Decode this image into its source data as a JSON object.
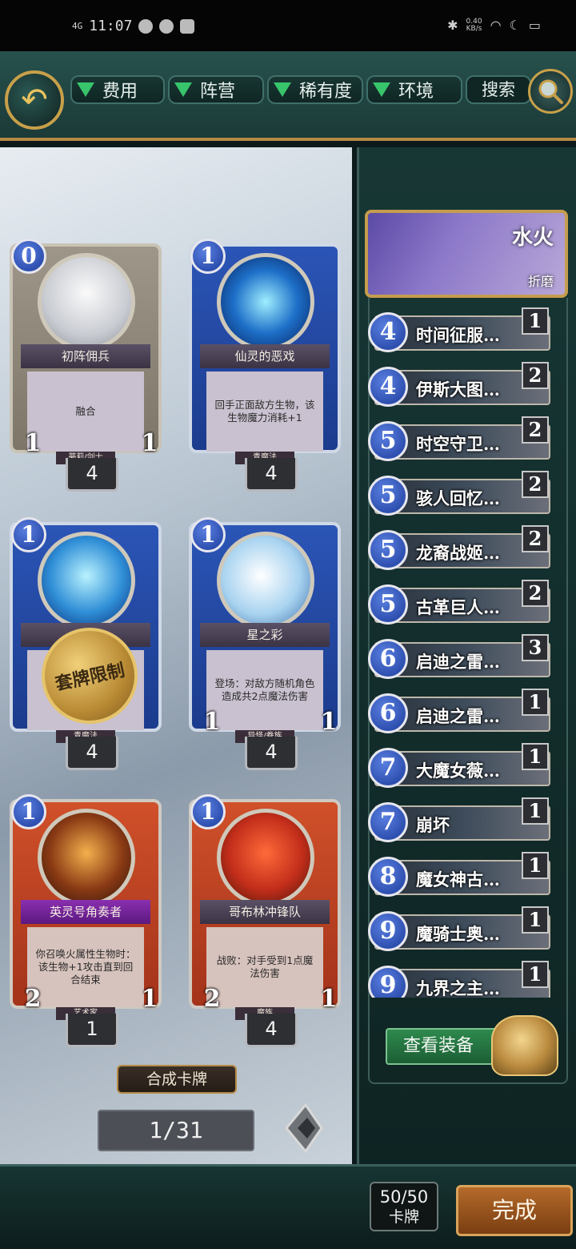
{
  "status_bar": {
    "network": "4G",
    "time": "11:07",
    "speed_top": "0.40",
    "speed_unit": "KB/s"
  },
  "filters": [
    {
      "label": "费用"
    },
    {
      "label": "阵营"
    },
    {
      "label": "稀有度"
    },
    {
      "label": "环境"
    }
  ],
  "search": {
    "label": "搜索"
  },
  "cards": [
    {
      "name": "初阵佣兵",
      "cost": "0",
      "desc": "融合",
      "tribe": "夢莉/剑士",
      "atk": "1",
      "hp": "1",
      "count": "4"
    },
    {
      "name": "仙灵的恶戏",
      "cost": "1",
      "desc": "回手正面敌方生物，该生物魔力消耗+1",
      "tribe": "青魔法",
      "atk": "",
      "hp": "",
      "count": "4"
    },
    {
      "name": "",
      "cost": "1",
      "desc": "",
      "tribe": "青魔法",
      "atk": "",
      "hp": "",
      "count": "4",
      "seal": "套牌限制"
    },
    {
      "name": "星之彩",
      "cost": "1",
      "desc": "登场：对敌方随机角色造成共2点魔法伤害",
      "tribe": "异怪/眷族",
      "atk": "1",
      "hp": "1",
      "count": "4"
    },
    {
      "name": "英灵号角奏者",
      "cost": "1",
      "desc": "你召唤火属性生物时：该生物+1攻击直到回合结束",
      "tribe": "艺术家",
      "atk": "2",
      "hp": "1",
      "count": "1"
    },
    {
      "name": "哥布林冲锋队",
      "cost": "1",
      "desc": "战败：对手受到1点魔法伤害",
      "tribe": "魔族",
      "atk": "2",
      "hp": "1",
      "count": "4"
    }
  ],
  "synth_button": "合成卡牌",
  "pager": "1/31",
  "deck": {
    "hero_name": "水火",
    "hero_sub": "折磨",
    "items": [
      {
        "cost": "4",
        "name": "时间征服…",
        "count": "1"
      },
      {
        "cost": "4",
        "name": "伊斯大图…",
        "count": "2"
      },
      {
        "cost": "5",
        "name": "时空守卫…",
        "count": "2"
      },
      {
        "cost": "5",
        "name": "骇人回忆…",
        "count": "2"
      },
      {
        "cost": "5",
        "name": "龙裔战姬…",
        "count": "2"
      },
      {
        "cost": "5",
        "name": "古革巨人…",
        "count": "2"
      },
      {
        "cost": "6",
        "name": "启迪之雷…",
        "count": "3"
      },
      {
        "cost": "6",
        "name": "启迪之雷…",
        "count": "1"
      },
      {
        "cost": "7",
        "name": "大魔女薇…",
        "count": "1"
      },
      {
        "cost": "7",
        "name": "崩坏",
        "count": "1"
      },
      {
        "cost": "8",
        "name": "魔女神古…",
        "count": "1"
      },
      {
        "cost": "9",
        "name": "魔骑士奥…",
        "count": "1"
      },
      {
        "cost": "9",
        "name": "九界之主…",
        "count": "1"
      }
    ],
    "equip_button": "查看装备"
  },
  "bottom": {
    "deck_count": "50/50",
    "deck_count_label": "卡牌",
    "done_button": "完成"
  }
}
